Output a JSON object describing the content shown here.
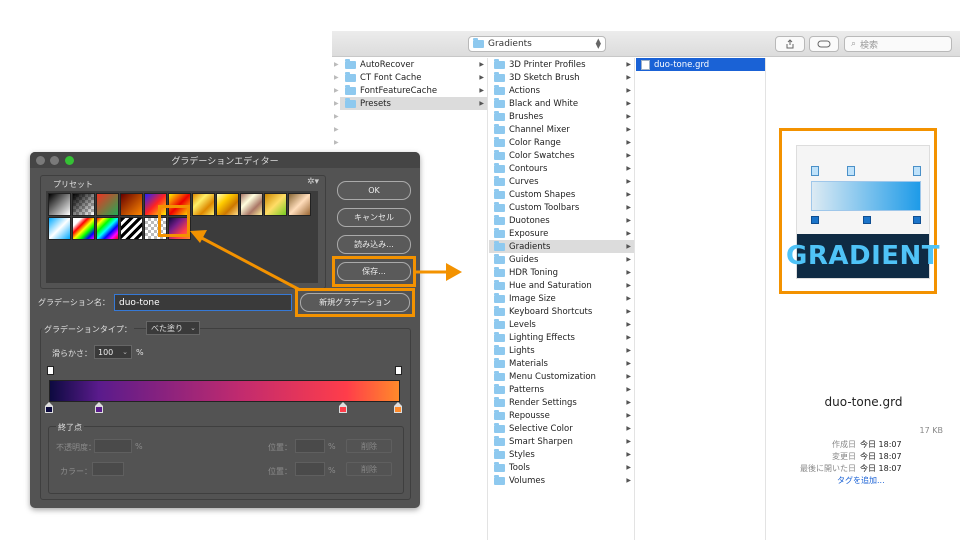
{
  "colors": {
    "highlight": "#f39200",
    "selection": "#1a62d6"
  },
  "finder": {
    "path": "Gradients",
    "search_placeholder": "検索",
    "col1": [
      {
        "label": "AutoRecover",
        "selected": false
      },
      {
        "label": "CT Font Cache",
        "selected": false
      },
      {
        "label": "FontFeatureCache",
        "selected": false
      },
      {
        "label": "Presets",
        "selected": true
      }
    ],
    "col2": [
      {
        "label": "3D Printer Profiles"
      },
      {
        "label": "3D Sketch Brush"
      },
      {
        "label": "Actions"
      },
      {
        "label": "Black and White"
      },
      {
        "label": "Brushes"
      },
      {
        "label": "Channel Mixer"
      },
      {
        "label": "Color Range"
      },
      {
        "label": "Color Swatches"
      },
      {
        "label": "Contours"
      },
      {
        "label": "Curves"
      },
      {
        "label": "Custom Shapes"
      },
      {
        "label": "Custom Toolbars"
      },
      {
        "label": "Duotones"
      },
      {
        "label": "Exposure"
      },
      {
        "label": "Gradients",
        "selected": true
      },
      {
        "label": "Guides"
      },
      {
        "label": "HDR Toning"
      },
      {
        "label": "Hue and Saturation"
      },
      {
        "label": "Image Size"
      },
      {
        "label": "Keyboard Shortcuts"
      },
      {
        "label": "Levels"
      },
      {
        "label": "Lighting Effects"
      },
      {
        "label": "Lights"
      },
      {
        "label": "Materials"
      },
      {
        "label": "Menu Customization"
      },
      {
        "label": "Patterns"
      },
      {
        "label": "Render Settings"
      },
      {
        "label": "Repousse"
      },
      {
        "label": "Selective Color"
      },
      {
        "label": "Smart Sharpen"
      },
      {
        "label": "Styles"
      },
      {
        "label": "Tools"
      },
      {
        "label": "Volumes"
      }
    ],
    "col3": [
      {
        "label": "duo-tone.grd"
      }
    ],
    "preview": {
      "thumb_label": "GRADIENT",
      "name": "duo-tone.grd",
      "size": "17 KB",
      "meta": [
        {
          "key": "作成日",
          "value": "今日 18:07"
        },
        {
          "key": "変更日",
          "value": "今日 18:07"
        },
        {
          "key": "最後に開いた日",
          "value": "今日 18:07"
        }
      ],
      "add_tag": "タグを追加..."
    }
  },
  "dialog": {
    "title": "グラデーションエディター",
    "preset_label": "プリセット",
    "buttons": {
      "ok": "OK",
      "cancel": "キャンセル",
      "load": "読み込み...",
      "save": "保存...",
      "new": "新規グラデーション"
    },
    "name_label": "グラデーション名：",
    "name_value": "duo-tone",
    "type_label": "グラデーションタイプ：",
    "type_value": "べた塗り",
    "smooth_label": "滑らかさ：",
    "smooth_value": "100",
    "smooth_unit": "%",
    "stops_label": "終了点",
    "opacity_label": "不透明度：",
    "color_label": "カラー：",
    "location_label": "位置：",
    "percent": "%",
    "delete_label": "削除",
    "ramp_colors": [
      "#0d0a40",
      "#5a1b8c",
      "#c22b6e",
      "#ff3d4a",
      "#ff8a2a"
    ]
  }
}
